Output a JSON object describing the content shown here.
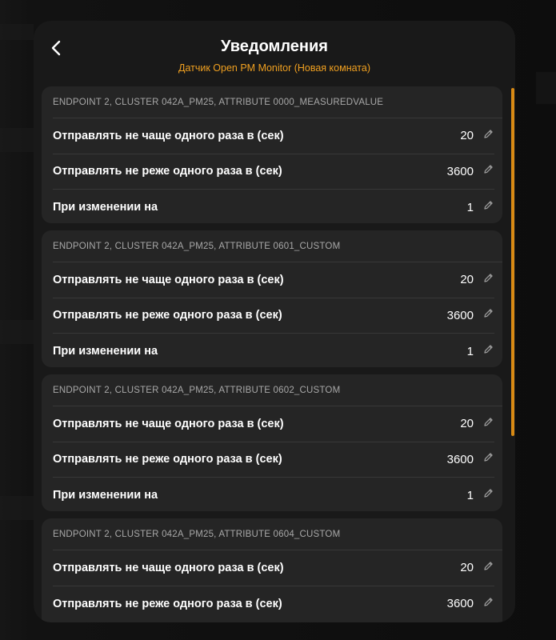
{
  "header": {
    "title": "Уведомления",
    "subtitle": "Датчик Open PM Monitor (Новая комната)"
  },
  "accent_color": "#f0a020",
  "cards": [
    {
      "title": "ENDPOINT 2, CLUSTER 042A_PM25, ATTRIBUTE 0000_MEASUREDVALUE",
      "rows": [
        {
          "label": "Отправлять не чаще одного раза в (сек)",
          "value": "20"
        },
        {
          "label": "Отправлять не реже одного раза в (сек)",
          "value": "3600"
        },
        {
          "label": "При изменении на",
          "value": "1"
        }
      ]
    },
    {
      "title": "ENDPOINT 2, CLUSTER 042A_PM25, ATTRIBUTE 0601_CUSTOM",
      "rows": [
        {
          "label": "Отправлять не чаще одного раза в (сек)",
          "value": "20"
        },
        {
          "label": "Отправлять не реже одного раза в (сек)",
          "value": "3600"
        },
        {
          "label": "При изменении на",
          "value": "1"
        }
      ]
    },
    {
      "title": "ENDPOINT 2, CLUSTER 042A_PM25, ATTRIBUTE 0602_CUSTOM",
      "rows": [
        {
          "label": "Отправлять не чаще одного раза в (сек)",
          "value": "20"
        },
        {
          "label": "Отправлять не реже одного раза в (сек)",
          "value": "3600"
        },
        {
          "label": "При изменении на",
          "value": "1"
        }
      ]
    },
    {
      "title": "ENDPOINT 2, CLUSTER 042A_PM25, ATTRIBUTE 0604_CUSTOM",
      "rows": [
        {
          "label": "Отправлять не чаще одного раза в (сек)",
          "value": "20"
        },
        {
          "label": "Отправлять не реже одного раза в (сек)",
          "value": "3600"
        }
      ]
    }
  ]
}
